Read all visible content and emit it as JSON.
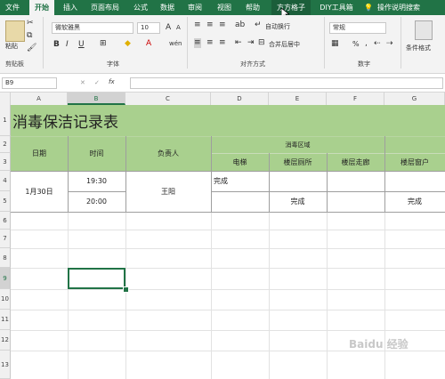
{
  "menu": {
    "tabs": [
      "文件",
      "开始",
      "插入",
      "页面布局",
      "公式",
      "数据",
      "审阅",
      "视图",
      "帮助",
      "方方格子",
      "DIY工具箱",
      "操作说明搜索"
    ],
    "active": "开始"
  },
  "ribbon": {
    "clipboard": {
      "paste_label": "粘贴",
      "group_label": "剪贴板"
    },
    "font": {
      "name": "微软雅黑",
      "size": "10",
      "bold": "B",
      "italic": "I",
      "underline": "U",
      "grow": "A",
      "shrink": "A",
      "wen": "wén",
      "group_label": "字体"
    },
    "alignment": {
      "wrap": "自动换行",
      "merge": "合并后居中",
      "group_label": "对齐方式"
    },
    "number": {
      "format": "常规",
      "percent": "%",
      "comma": ",",
      "group_label": "数字"
    },
    "styles": {
      "conditional": "条件格式"
    }
  },
  "formula_bar": {
    "name_box": "B9",
    "cancel": "✕",
    "confirm": "✓",
    "fx": "fx",
    "value": ""
  },
  "columns": [
    "A",
    "B",
    "C",
    "D",
    "E",
    "F",
    "G"
  ],
  "rows": [
    "1",
    "2",
    "3",
    "4",
    "5",
    "6",
    "7",
    "8",
    "9",
    "10",
    "11",
    "12",
    "13"
  ],
  "sheet": {
    "title": "消毒保洁记录表",
    "headers": {
      "date": "日期",
      "time": "时间",
      "person": "负责人",
      "area": "消毒区域"
    },
    "areas": [
      "电梯",
      "楼层厕所",
      "楼层走廊",
      "楼层窗户"
    ],
    "record": {
      "date": "1月30日",
      "time1": "19:30",
      "time2": "20:00",
      "person": "王阳",
      "d4": "完成",
      "e5": "完成",
      "g5": "完成"
    }
  },
  "watermark": "Baidu 经验"
}
